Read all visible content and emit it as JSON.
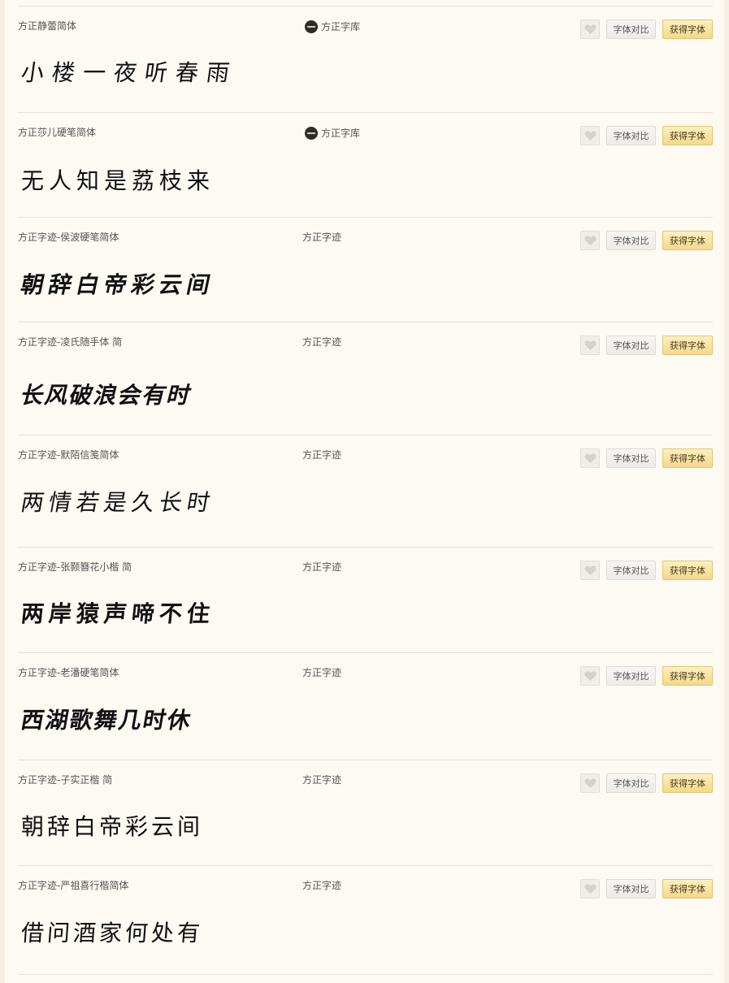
{
  "buttons": {
    "compare": "字体对比",
    "get": "获得字体"
  },
  "fonts": [
    {
      "name": "方正静蕾简体",
      "foundry": "方正字库",
      "sample": "小楼一夜听春雨",
      "has_logo": true
    },
    {
      "name": "方正莎儿硬笔简体",
      "foundry": "方正字库",
      "sample": "无人知是荔枝来",
      "has_logo": true
    },
    {
      "name": "方正字迹-侯波硬笔简体",
      "foundry": "方正字迹",
      "sample": "朝辞白帝彩云间",
      "has_logo": false
    },
    {
      "name": "方正字迹-凌氏随手体 简",
      "foundry": "方正字迹",
      "sample": "长风破浪会有时",
      "has_logo": false
    },
    {
      "name": "方正字迹-默陌信笺简体",
      "foundry": "方正字迹",
      "sample": "两情若是久长时",
      "has_logo": false
    },
    {
      "name": "方正字迹-张颢簪花小楷 简",
      "foundry": "方正字迹",
      "sample": "两岸猿声啼不住",
      "has_logo": false
    },
    {
      "name": "方正字迹-老潘硬笔简体",
      "foundry": "方正字迹",
      "sample": "西湖歌舞几时休",
      "has_logo": false
    },
    {
      "name": "方正字迹-子实正楷 简",
      "foundry": "方正字迹",
      "sample": "朝辞白帝彩云间",
      "has_logo": false
    },
    {
      "name": "方正字迹-严祖喜行楷简体",
      "foundry": "方正字迹",
      "sample": "借问酒家何处有",
      "has_logo": false
    }
  ],
  "icons": {
    "favorite": "heart-icon",
    "foundry_logo": "foundry-logo-icon"
  },
  "colors": {
    "get_button": "#f3d98a",
    "background": "#fdf9f3"
  }
}
